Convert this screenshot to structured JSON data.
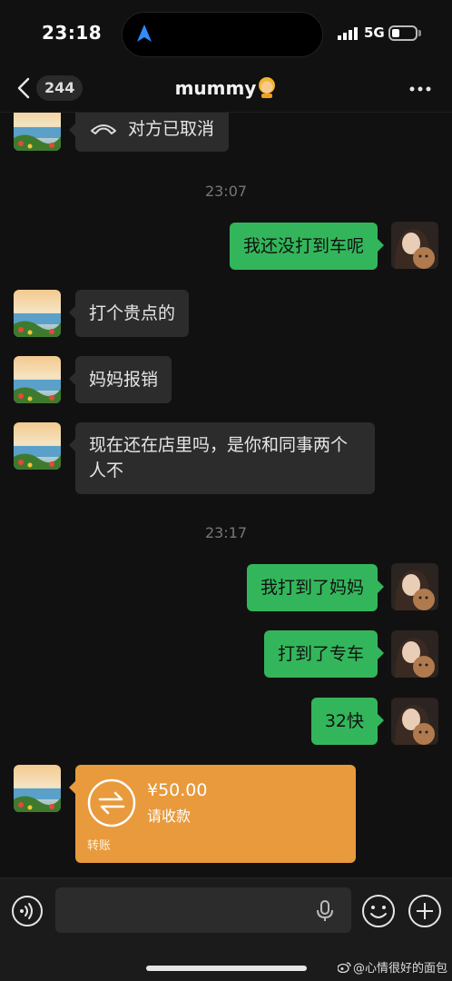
{
  "status_bar": {
    "time": "23:18",
    "network": "5G"
  },
  "header": {
    "back_count": "244",
    "title": "mummy",
    "title_emoji": "woman-emoji"
  },
  "messages": [
    {
      "side": "left",
      "type": "call",
      "text": "对方已取消",
      "icon": "phone-hangup-icon"
    },
    {
      "type": "timestamp",
      "text": "23:07"
    },
    {
      "side": "right",
      "text": "我还没打到车呢"
    },
    {
      "side": "left",
      "text": "打个贵点的"
    },
    {
      "side": "left",
      "text": "妈妈报销"
    },
    {
      "side": "left",
      "text": "现在还在店里吗，是你和同事两个人不"
    },
    {
      "type": "timestamp",
      "text": "23:17"
    },
    {
      "side": "right",
      "text": "我打到了妈妈"
    },
    {
      "side": "right",
      "text": "打到了专车"
    },
    {
      "side": "right",
      "text": "32快"
    },
    {
      "side": "left",
      "type": "transfer",
      "amount": "¥50.00",
      "status": "请收款",
      "label": "转账"
    }
  ],
  "input_bar": {
    "placeholder": ""
  },
  "watermark": "@心情很好的面包",
  "colors": {
    "bubble_sent": "#33b65b",
    "bubble_received": "#2c2c2c",
    "transfer": "#e89a3c",
    "background": "#111111"
  }
}
